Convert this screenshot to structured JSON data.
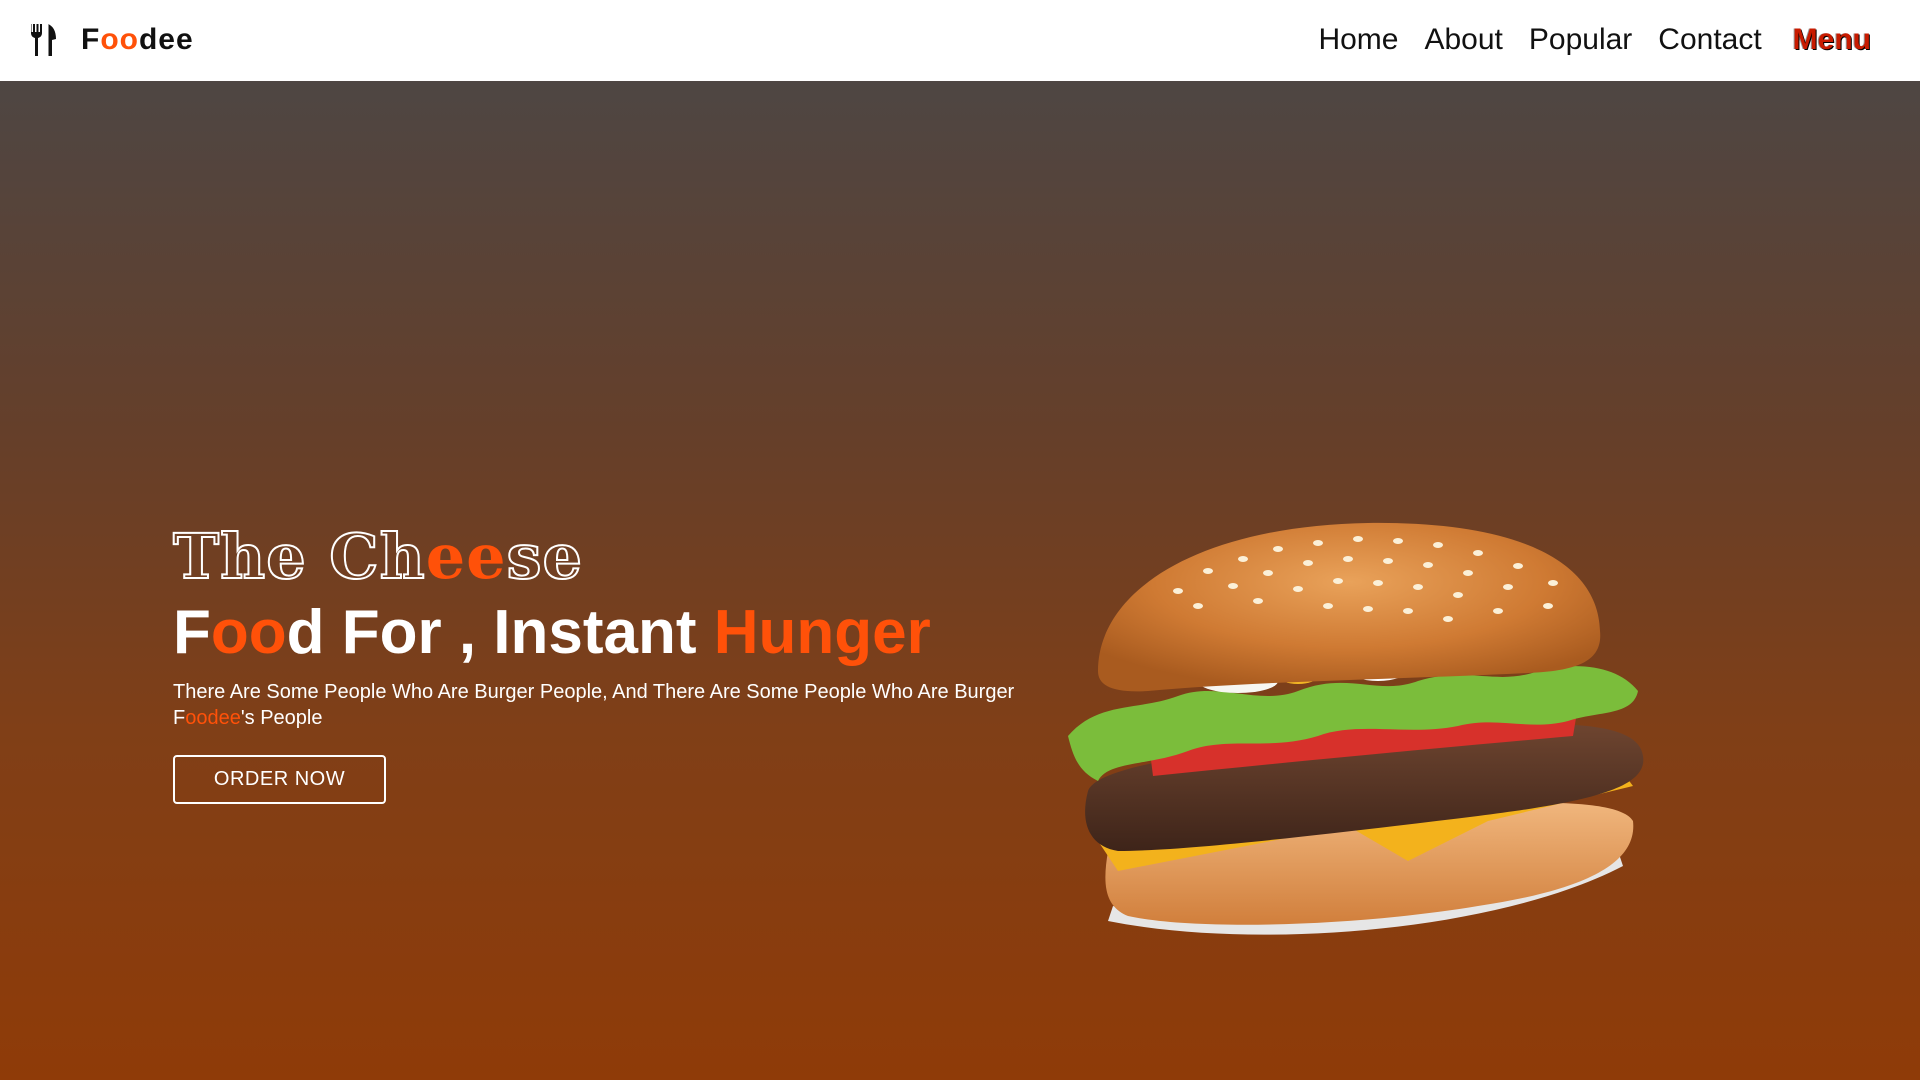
{
  "brand": {
    "icon": "fork-knife-icon",
    "name_parts": [
      "F",
      "oo",
      "dee"
    ]
  },
  "nav": {
    "items": [
      {
        "label": "Home"
      },
      {
        "label": "About"
      },
      {
        "label": "Popular"
      },
      {
        "label": "Contact"
      }
    ],
    "menu_label": "Menu"
  },
  "hero": {
    "title_line1_parts": [
      "Th",
      "e",
      " Ch",
      "ee",
      "se"
    ],
    "title_line2_parts": [
      "F",
      "oo",
      "d For , Instant ",
      "Hunger"
    ],
    "description_part1": "There Are Some People Who Are Burger People, And There Are Some People Who Are Burger F",
    "description_accent": "oodee",
    "description_part2": "'s People",
    "cta_label": "ORDER NOW",
    "image": "cheeseburger-image"
  },
  "colors": {
    "accent": "#ff5109",
    "menu": "#c81b00",
    "gradient_top": "#4e4643",
    "gradient_bottom": "#8f3b08"
  }
}
